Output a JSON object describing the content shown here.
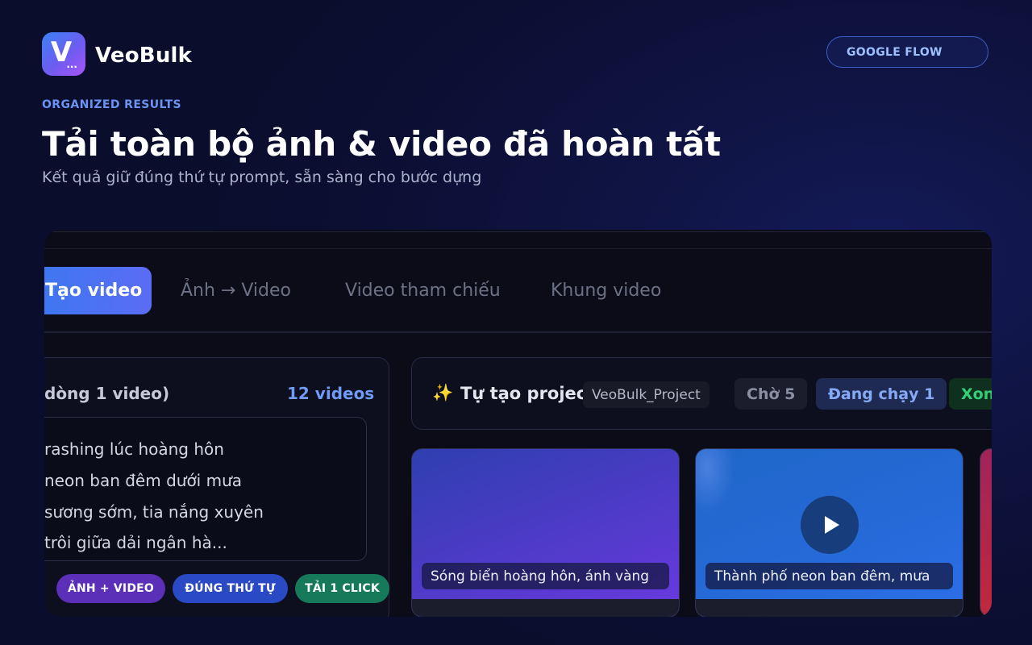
{
  "brand": {
    "logo_letter": "V",
    "logo_dots": "...",
    "name": "VeoBulk"
  },
  "header": {
    "flow_button": "GOOGLE FLOW"
  },
  "hero": {
    "eyebrow": "ORGANIZED RESULTS",
    "title": "Tải toàn bộ ảnh & video đã hoàn tất",
    "subtitle": "Kết quả giữ đúng thứ tự prompt, sẵn sàng cho bước dựng"
  },
  "tabs": [
    {
      "label": "Tạo video",
      "active": true
    },
    {
      "label": "Ảnh → Video",
      "active": false
    },
    {
      "label": "Video tham chiếu",
      "active": false
    },
    {
      "label": "Khung video",
      "active": false
    }
  ],
  "prompts_card": {
    "title": "dòng 1 video)",
    "count": "12 videos",
    "lines": [
      "rashing lúc hoàng hôn",
      "neon ban đêm dưới mưa",
      " sương sớm, tia nắng xuyên",
      " trôi giữa dải ngân hà..."
    ]
  },
  "chips": [
    {
      "label": "ẢNH + VIDEO",
      "color": "#5b2fb8"
    },
    {
      "label": "ĐÚNG THỨ TỰ",
      "color": "#2a49c4"
    },
    {
      "label": "TẢI 1 CLICK",
      "color": "#16795a"
    }
  ],
  "project": {
    "spark_icon": "✨",
    "label": "Tự tạo project",
    "name": "VeoBulk_Project",
    "badges": {
      "wait": "Chờ 5",
      "running": "Đang chạy 1",
      "done": "Xon"
    }
  },
  "videos": [
    {
      "caption": "Sóng biển hoàng hôn, ánh vàng",
      "has_play": false
    },
    {
      "caption": "Thành phố neon ban đêm, mưa",
      "has_play": true
    }
  ],
  "colors": {
    "accent": "#3b78f0",
    "count": "#6f9af5",
    "success": "#33d07a"
  }
}
